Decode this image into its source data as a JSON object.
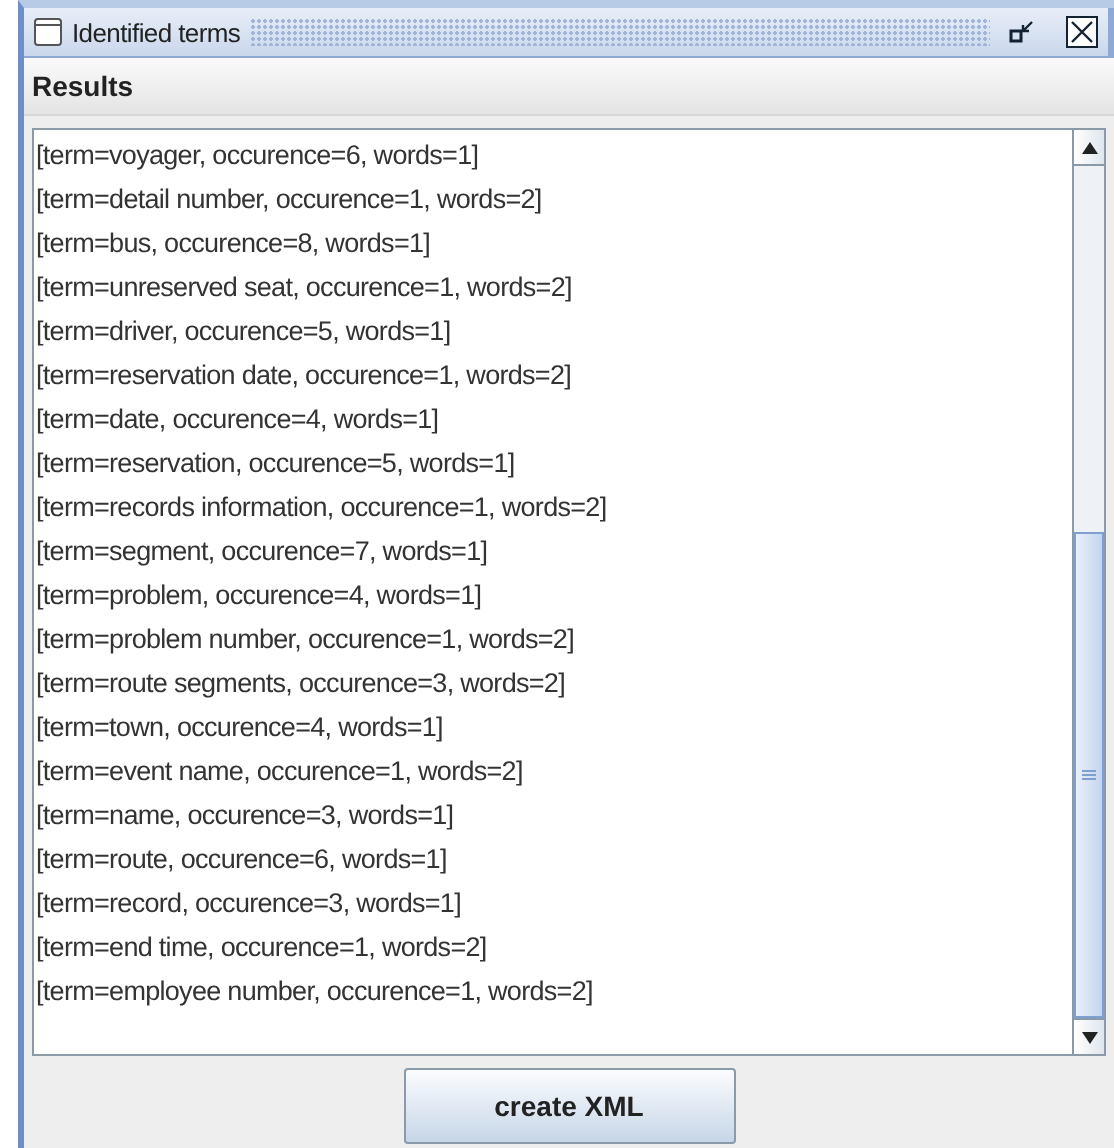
{
  "window": {
    "title": "Identified terms"
  },
  "section": {
    "title": "Results"
  },
  "results": [
    "[term=voyager, occurence=6, words=1]",
    "[term=detail number, occurence=1, words=2]",
    "[term=bus, occurence=8, words=1]",
    "[term=unreserved seat, occurence=1, words=2]",
    "[term=driver, occurence=5, words=1]",
    "[term=reservation date, occurence=1, words=2]",
    "[term=date, occurence=4, words=1]",
    "[term=reservation, occurence=5, words=1]",
    "[term=records information, occurence=1, words=2]",
    "[term=segment, occurence=7, words=1]",
    "[term=problem, occurence=4, words=1]",
    "[term=problem number, occurence=1, words=2]",
    "[term=route segments, occurence=3, words=2]",
    "[term=town, occurence=4, words=1]",
    "[term=event name, occurence=1, words=2]",
    "[term=name, occurence=3, words=1]",
    "[term=route, occurence=6, words=1]",
    "[term=record, occurence=3, words=1]",
    "[term=end time, occurence=1, words=2]",
    "[term=employee number, occurence=1, words=2]"
  ],
  "buttons": [
    "create XML"
  ]
}
